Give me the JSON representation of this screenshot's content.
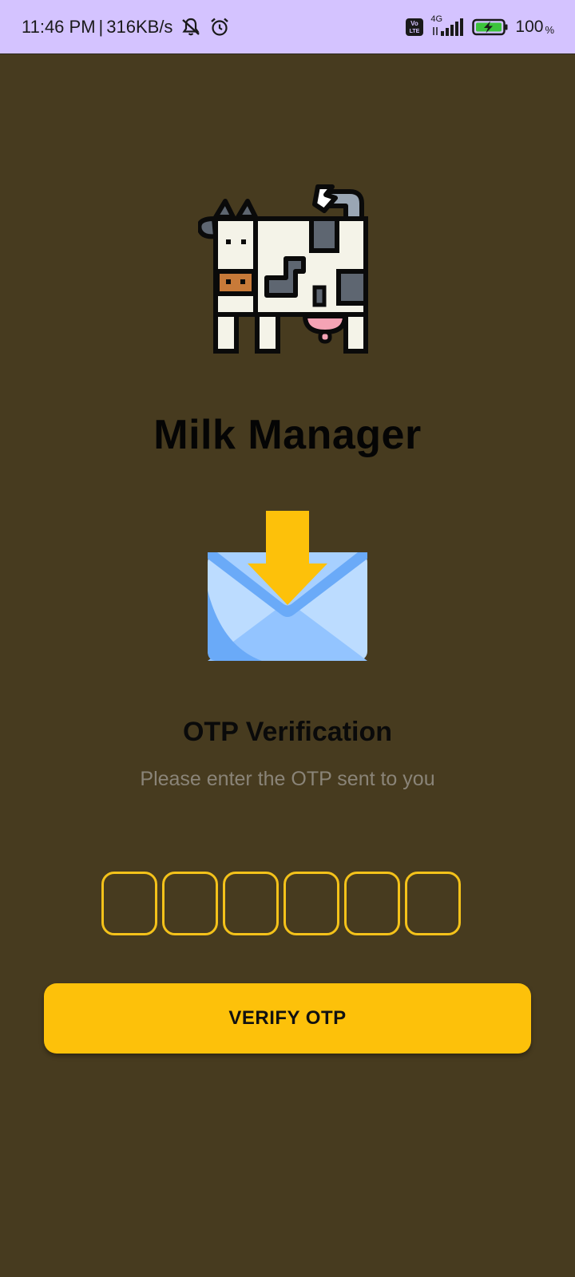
{
  "status_bar": {
    "time": "11:46 PM",
    "separator": "|",
    "speed": "316KB/s",
    "network_type": "4G",
    "volte_badge": "Vo LTE",
    "battery_percent": "100",
    "battery_percent_symbol": "%",
    "icons": [
      "bell-off-icon",
      "alarm-icon",
      "volte-icon",
      "signal-icon",
      "battery-charging-icon"
    ]
  },
  "app": {
    "title": "Milk Manager",
    "logo_icon": "cow-icon",
    "mail_icon": "mail-download-icon"
  },
  "otp": {
    "title": "OTP Verification",
    "subtitle": "Please enter the OTP sent to you",
    "digit_count": 6,
    "digits": [
      "",
      "",
      "",
      "",
      "",
      ""
    ],
    "button_label": "VERIFY OTP"
  },
  "colors": {
    "background": "#473b1f",
    "status_bar": "#d4c3ff",
    "accent": "#fdc10a",
    "otp_border": "#f4c21a"
  }
}
